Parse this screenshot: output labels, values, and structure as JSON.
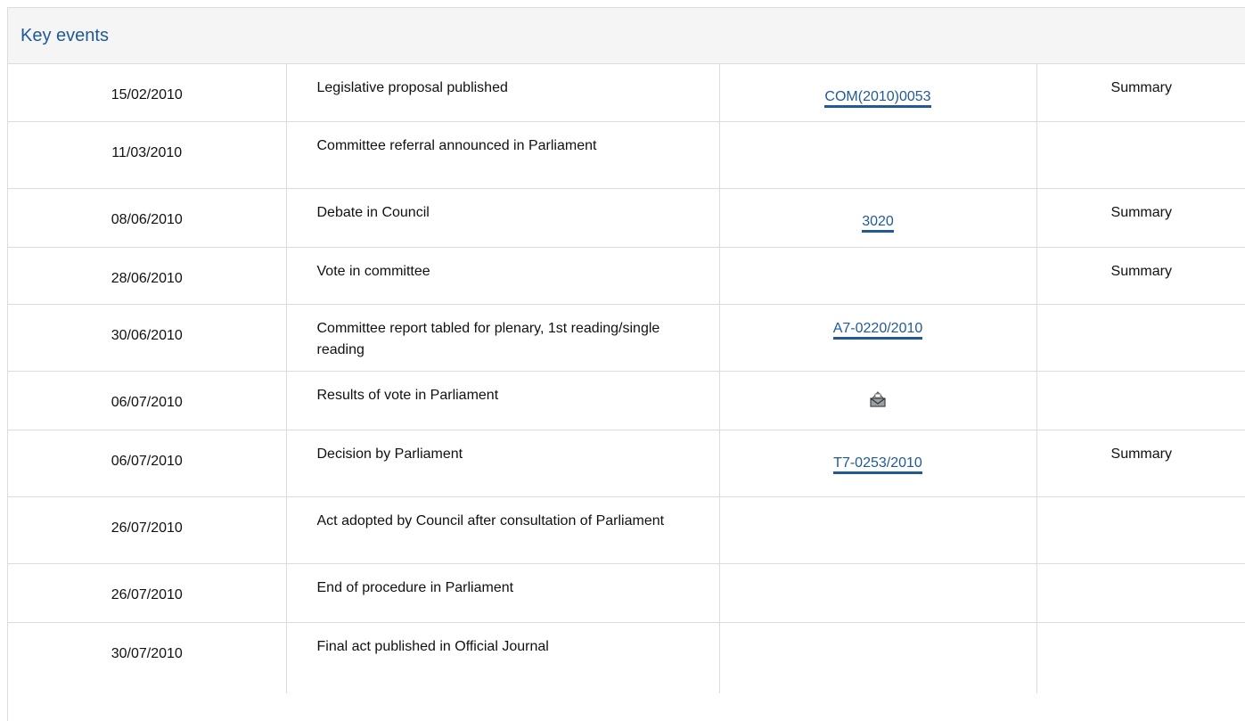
{
  "section": {
    "title": "Key events"
  },
  "events": [
    {
      "date": "15/02/2010",
      "event": "Legislative proposal published",
      "reference": "COM(2010)0053",
      "summary": "Summary"
    },
    {
      "date": "11/03/2010",
      "event": "Committee referral announced in Parliament",
      "reference": "",
      "summary": ""
    },
    {
      "date": "08/06/2010",
      "event": "Debate in Council",
      "reference": "3020",
      "summary": "Summary"
    },
    {
      "date": "28/06/2010",
      "event": "Vote in committee",
      "reference": "",
      "summary": "Summary"
    },
    {
      "date": "30/06/2010",
      "event": "Committee report tabled for plenary, 1st reading/single reading",
      "reference": "A7-0220/2010",
      "summary": ""
    },
    {
      "date": "06/07/2010",
      "event": "Results of vote in Parliament",
      "reference_icon": "ballot-box-icon",
      "summary": ""
    },
    {
      "date": "06/07/2010",
      "event": "Decision by Parliament",
      "reference": "T7-0253/2010",
      "summary": "Summary"
    },
    {
      "date": "26/07/2010",
      "event": "Act adopted by Council after consultation of Parliament",
      "reference": "",
      "summary": ""
    },
    {
      "date": "26/07/2010",
      "event": "End of procedure in Parliament",
      "reference": "",
      "summary": ""
    },
    {
      "date": "30/07/2010",
      "event": "Final act published in Official Journal",
      "reference": "",
      "summary": ""
    }
  ],
  "colors": {
    "link": "#1f5a96",
    "border": "#dcdcdc",
    "header_bg": "#f5f5f5"
  }
}
